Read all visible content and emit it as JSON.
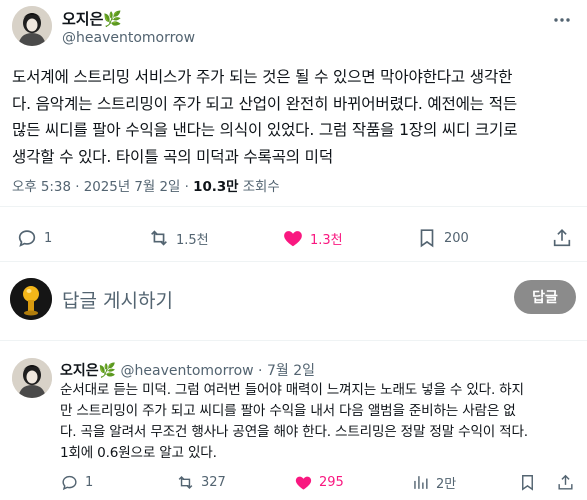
{
  "post": {
    "author_name": "오지은",
    "author_badge": "🌿",
    "handle": "@heaventomorrow",
    "body_lines": [
      "도서계에 스트리밍 서비스가 주가 되는 것은 될 수 있으면 막아야한다고 생각한",
      "다. 음악계는 스트리밍이 주가 되고 산업이 완전히 바뀌어버렸다. 예전에는 적든",
      "많든 씨디를 팔아 수익을 낸다는 의식이 있었다. 그럼 작품을 1장의 씨디 크기로",
      "생각할 수 있다. 타이틀 곡의 미덕과 수록곡의 미덕"
    ],
    "time": "오후 5:38",
    "separator": " · ",
    "date": "2025년 7월 2일",
    "views": "10.3만",
    "views_label": " 조회수",
    "stats": {
      "replies": "1",
      "reposts": "1.5천",
      "likes": "1.3천",
      "bookmarks": "200"
    },
    "like_color": "#f91880"
  },
  "reply_box": {
    "placeholder": "답글 게시하기",
    "button_label": "답글"
  },
  "reply": {
    "author_name": "오지은",
    "author_badge": "🌿",
    "handle": "@heaventomorrow",
    "separator": " · ",
    "date": "7월 2일",
    "body_lines": [
      "순서대로 듣는 미덕. 그럼 여러번 들어야 매력이 느껴지는 노래도 넣을 수 있다. 하지",
      "만 스트리밍이 주가 되고 씨디를 팔아 수익을 내서 다음 앨범을 준비하는 사람은 없",
      "다. 곡을 알려서 무조건 행사나 공연을 해야 한다. 스트리밍은 정말 정말 수익이 적다.",
      "1회에 0.6원으로 알고 있다."
    ],
    "stats": {
      "replies": "1",
      "reposts": "327",
      "likes": "295",
      "views": "2만"
    }
  }
}
